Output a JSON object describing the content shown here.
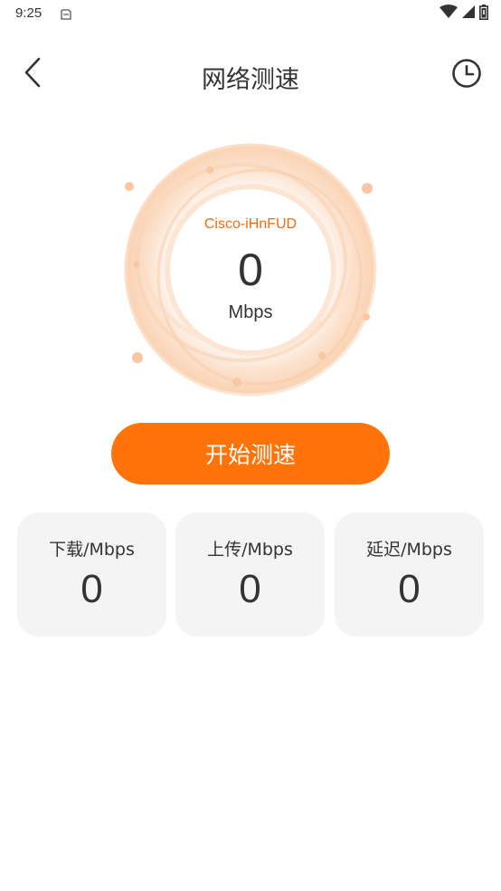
{
  "status_bar": {
    "time": "9:25",
    "icons": [
      "notification-icon",
      "wifi-icon",
      "signal-icon",
      "battery-icon"
    ]
  },
  "header": {
    "title": "网络测速",
    "back_icon": "chevron-left-icon",
    "history_icon": "clock-icon"
  },
  "gauge": {
    "ssid": "Cisco-iHnFUD",
    "value": "0",
    "unit": "Mbps"
  },
  "start_button": {
    "label": "开始测速"
  },
  "stats": [
    {
      "label": "下载/Mbps",
      "value": "0"
    },
    {
      "label": "上传/Mbps",
      "value": "0"
    },
    {
      "label": "延迟/Mbps",
      "value": "0"
    }
  ],
  "colors": {
    "accent": "#FF7308",
    "ssid": "#F26C0D",
    "card_bg": "#F4F4F4",
    "ring_light": "#FDE5D1",
    "text": "#333333"
  }
}
